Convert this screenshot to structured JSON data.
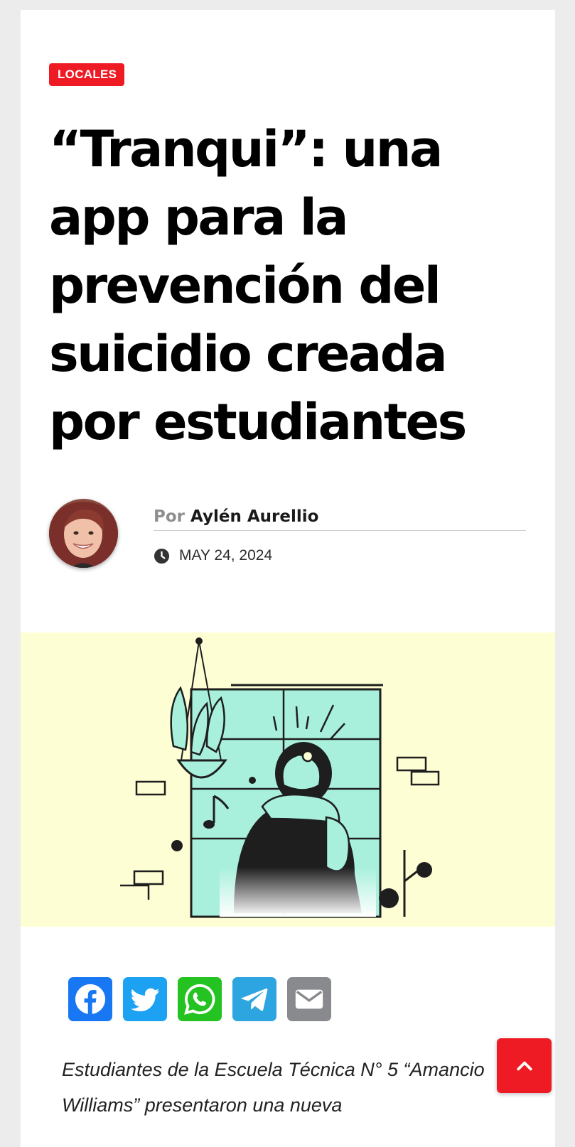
{
  "article": {
    "category": "LOCALES",
    "title": "“Tranqui”: una app para la prevención del suicidio creada por estudiantes",
    "byline_prefix": "Por",
    "author": "Aylén Aurellio",
    "date": "MAY 24, 2024",
    "excerpt": "Estudiantes de la Escuela Técnica N° 5 “Amancio Williams” presentaron una nueva"
  },
  "share": [
    {
      "name": "Facebook",
      "color": "#1877f2",
      "icon": "facebook-icon"
    },
    {
      "name": "Twitter",
      "color": "#1da1f2",
      "icon": "twitter-icon"
    },
    {
      "name": "WhatsApp",
      "color": "#25c322",
      "icon": "whatsapp-icon"
    },
    {
      "name": "Telegram",
      "color": "#2ca5e0",
      "icon": "telegram-icon"
    },
    {
      "name": "Email",
      "color": "#888a8e",
      "icon": "email-icon"
    }
  ],
  "colors": {
    "accent": "#ee1b24",
    "featured_background": "#fdfed4",
    "illustration_mint": "#a8f0dc"
  }
}
